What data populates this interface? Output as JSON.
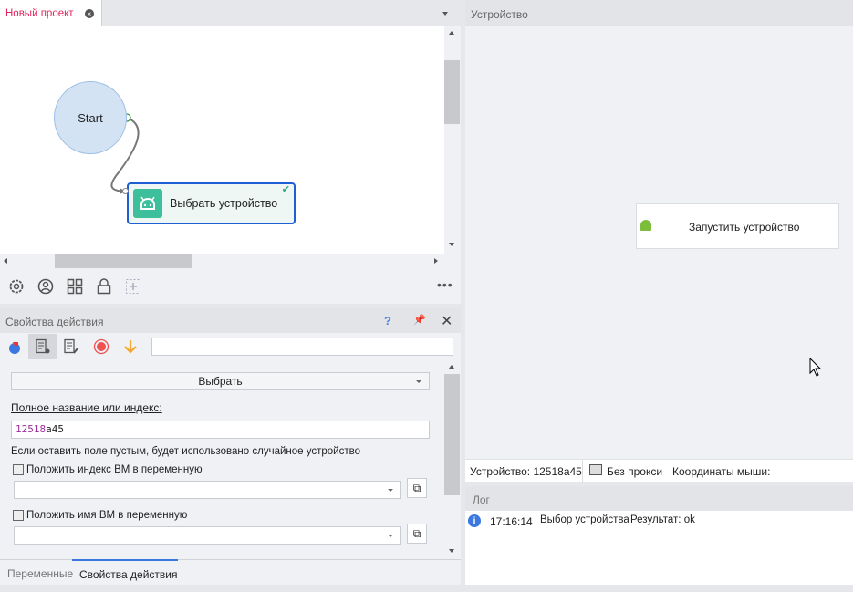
{
  "project_tab": {
    "label": "Новый проект",
    "color": "#e0245e"
  },
  "canvas": {
    "start_label": "Start",
    "node_label": "Выбрать устройство"
  },
  "toolbar_icons": [
    "settings-icon",
    "user-icon",
    "grid-icon",
    "lock-icon",
    "add-icon",
    "more-icon"
  ],
  "properties": {
    "title": "Свойства действия",
    "help": "?",
    "dropdown_value": "Выбрать",
    "field_label": "Полное название или индекс:",
    "field_value_digits": "12518",
    "field_value_rest": "a45",
    "hint": "Если оставить поле пустым, будет использовано случайное устройство",
    "save_index_label": "Положить индекс ВМ в переменную",
    "save_name_label": "Положить имя ВМ в переменную",
    "search_value": ""
  },
  "bottom_tabs": [
    {
      "label": "Переменные",
      "active": false
    },
    {
      "label": "Свойства действия",
      "active": true
    }
  ],
  "device": {
    "title": "Устройство",
    "launch_label": "Запустить устройство",
    "status_device": "Устройство: 12518a45",
    "status_proxy": "Без прокси",
    "status_mouse": "Координаты мыши:"
  },
  "log": {
    "title": "Лог",
    "entries": [
      {
        "time": "17:16:14",
        "message": "Выбор устройства",
        "result": "Результат: ok"
      }
    ]
  },
  "colors": {
    "accent": "#1e5fd6",
    "node_icon": "#3dbf9b",
    "start_fill": "#d3e3f4"
  }
}
